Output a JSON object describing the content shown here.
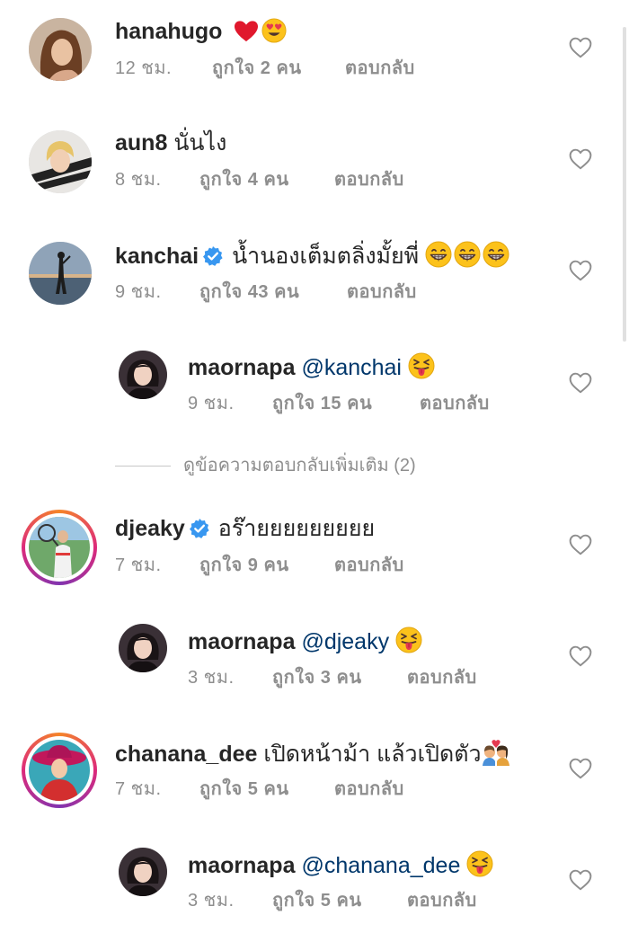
{
  "comments": [
    {
      "username": "hanahugo",
      "text": "",
      "emojis": [
        "red-heart",
        "heart-eyes"
      ],
      "time": "12 ชม.",
      "likes": "ถูกใจ 2 คน",
      "reply": "ตอบกลับ"
    },
    {
      "username": "aun8",
      "text": "นั่นไง",
      "time": "8 ชม.",
      "likes": "ถูกใจ 4 คน",
      "reply": "ตอบกลับ"
    },
    {
      "username": "kanchai",
      "verified": true,
      "text": "น้ำนองเต็มตลิ่งมั้ยพี่",
      "emojis": [
        "grin",
        "grin",
        "grin"
      ],
      "time": "9 ชม.",
      "likes": "ถูกใจ 43 คน",
      "reply": "ตอบกลับ"
    },
    {
      "username": "maornapa",
      "mention": "@kanchai",
      "emojis": [
        "squint-tongue"
      ],
      "time": "9 ชม.",
      "likes": "ถูกใจ 15 คน",
      "reply": "ตอบกลับ"
    },
    {
      "username": "djeaky",
      "verified": true,
      "text": "อร๊ายยยยยยยยย",
      "time": "7 ชม.",
      "likes": "ถูกใจ 9 คน",
      "reply": "ตอบกลับ"
    },
    {
      "username": "maornapa",
      "mention": "@djeaky",
      "emojis": [
        "squint-tongue"
      ],
      "time": "3 ชม.",
      "likes": "ถูกใจ 3 คน",
      "reply": "ตอบกลับ"
    },
    {
      "username": "chanana_dee",
      "text": "เปิดหน้าม้า  แล้วเปิดตัว",
      "emojis": [
        "kiss-couple"
      ],
      "time": "7 ชม.",
      "likes": "ถูกใจ 5 คน",
      "reply": "ตอบกลับ"
    },
    {
      "username": "maornapa",
      "mention": "@chanana_dee",
      "emojis": [
        "squint-tongue"
      ],
      "time": "3 ชม.",
      "likes": "ถูกใจ 5 คน",
      "reply": "ตอบกลับ"
    }
  ],
  "more_replies": "ดูข้อความตอบกลับเพิ่มเติม (2)",
  "icons": {
    "like": "heart-outline-icon",
    "verified": "verified-badge-icon"
  },
  "colors": {
    "text": "#262626",
    "meta": "#8e8e8e",
    "verified": "#3897f0",
    "mention": "#00376b",
    "story_ring": "#dd2a7b"
  }
}
